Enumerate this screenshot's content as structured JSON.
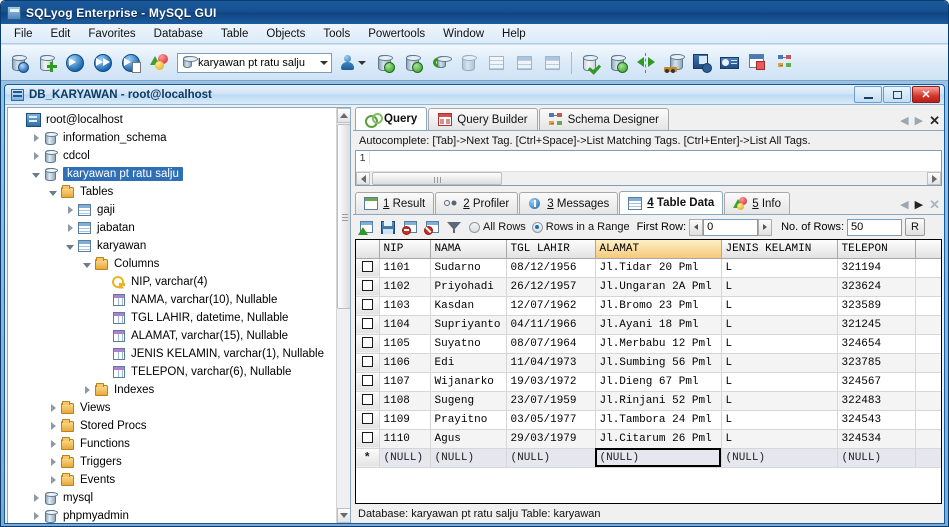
{
  "window": {
    "title": "SQLyog Enterprise - MySQL GUI",
    "icon": "sqlyog-app-icon"
  },
  "menu": {
    "items": [
      {
        "label": "File"
      },
      {
        "label": "Edit"
      },
      {
        "label": "Favorites"
      },
      {
        "label": "Database"
      },
      {
        "label": "Table"
      },
      {
        "label": "Objects"
      },
      {
        "label": "Tools"
      },
      {
        "label": "Powertools"
      },
      {
        "label": "Window"
      },
      {
        "label": "Help"
      }
    ]
  },
  "toolbar": {
    "db_selector_value": "karyawan pt ratu salju",
    "buttons": [
      {
        "name": "new-connection-icon"
      },
      {
        "name": "add-connection-icon"
      },
      {
        "name": "execute-query-icon"
      },
      {
        "name": "execute-all-queries-icon"
      },
      {
        "name": "execute-query-to-file-icon"
      },
      {
        "name": "refresh-object-browser-icon"
      }
    ],
    "buttons_right": [
      {
        "name": "user-manager-icon"
      },
      {
        "name": "import-data-icon"
      },
      {
        "name": "export-data-icon"
      },
      {
        "name": "restore-backup-icon"
      },
      {
        "name": "backup-database-icon"
      },
      {
        "name": "export-to-csv-icon"
      },
      {
        "name": "create-table-icon"
      },
      {
        "name": "alter-table-icon"
      },
      {
        "name": "sql-formatter-icon"
      },
      {
        "name": "database-sync-icon"
      },
      {
        "name": "data-sync-icon"
      },
      {
        "name": "migration-toolkit-icon"
      },
      {
        "name": "scheduled-backup-icon"
      },
      {
        "name": "notification-services-icon"
      },
      {
        "name": "query-formatter-icon"
      },
      {
        "name": "schema-designer-icon"
      }
    ]
  },
  "child_window": {
    "title": "DB_KARYAWAN - root@localhost",
    "controls": {
      "minimize": "minimize-button",
      "maximize": "maximize-button",
      "close": "close-button"
    }
  },
  "tree": {
    "nodes": [
      {
        "label": "root@localhost",
        "icon": "server-icon",
        "indent": 0,
        "twisty": "none",
        "selected": false
      },
      {
        "label": "information_schema",
        "icon": "database-icon",
        "indent": 1,
        "twisty": "closed",
        "selected": false
      },
      {
        "label": "cdcol",
        "icon": "database-icon",
        "indent": 1,
        "twisty": "closed",
        "selected": false
      },
      {
        "label": "karyawan pt ratu salju",
        "icon": "database-icon",
        "indent": 1,
        "twisty": "open",
        "selected": true
      },
      {
        "label": "Tables",
        "icon": "folder-icon",
        "indent": 2,
        "twisty": "open",
        "selected": false
      },
      {
        "label": "gaji",
        "icon": "table-icon",
        "indent": 3,
        "twisty": "closed",
        "selected": false
      },
      {
        "label": "jabatan",
        "icon": "table-icon",
        "indent": 3,
        "twisty": "closed",
        "selected": false
      },
      {
        "label": "karyawan",
        "icon": "table-icon",
        "indent": 3,
        "twisty": "open",
        "selected": false
      },
      {
        "label": "Columns",
        "icon": "folder-icon",
        "indent": 4,
        "twisty": "open",
        "selected": false
      },
      {
        "label": "NIP, varchar(4)",
        "icon": "primary-key-icon",
        "indent": 5,
        "twisty": "none",
        "selected": false
      },
      {
        "label": "NAMA, varchar(10), Nullable",
        "icon": "column-icon",
        "indent": 5,
        "twisty": "none",
        "selected": false
      },
      {
        "label": "TGL LAHIR, datetime, Nullable",
        "icon": "column-icon",
        "indent": 5,
        "twisty": "none",
        "selected": false
      },
      {
        "label": "ALAMAT, varchar(15), Nullable",
        "icon": "column-icon",
        "indent": 5,
        "twisty": "none",
        "selected": false
      },
      {
        "label": "JENIS KELAMIN, varchar(1), Nullable",
        "icon": "column-icon",
        "indent": 5,
        "twisty": "none",
        "selected": false
      },
      {
        "label": "TELEPON, varchar(6), Nullable",
        "icon": "column-icon",
        "indent": 5,
        "twisty": "none",
        "selected": false
      },
      {
        "label": "Indexes",
        "icon": "folder-icon",
        "indent": 4,
        "twisty": "closed",
        "selected": false
      },
      {
        "label": "Views",
        "icon": "folder-icon",
        "indent": 2,
        "twisty": "closed",
        "selected": false
      },
      {
        "label": "Stored Procs",
        "icon": "folder-icon",
        "indent": 2,
        "twisty": "closed",
        "selected": false
      },
      {
        "label": "Functions",
        "icon": "folder-icon",
        "indent": 2,
        "twisty": "closed",
        "selected": false
      },
      {
        "label": "Triggers",
        "icon": "folder-icon",
        "indent": 2,
        "twisty": "closed",
        "selected": false
      },
      {
        "label": "Events",
        "icon": "folder-icon",
        "indent": 2,
        "twisty": "closed",
        "selected": false
      },
      {
        "label": "mysql",
        "icon": "database-icon",
        "indent": 1,
        "twisty": "closed",
        "selected": false
      },
      {
        "label": "phpmyadmin",
        "icon": "database-icon",
        "indent": 1,
        "twisty": "closed",
        "selected": false
      }
    ]
  },
  "editor_tabs": {
    "tabs": [
      {
        "label": "Query",
        "icon": "query-icon",
        "active": true
      },
      {
        "label": "Query Builder",
        "icon": "query-builder-icon",
        "active": false
      },
      {
        "label": "Schema Designer",
        "icon": "schema-designer-icon",
        "active": false
      }
    ]
  },
  "autocomplete_hint": "Autocomplete: [Tab]->Next Tag. [Ctrl+Space]->List Matching Tags. [Ctrl+Enter]->List All Tags.",
  "sql_editor": {
    "line_number": "1",
    "text": ""
  },
  "result_tabs": {
    "tabs": [
      {
        "num": "1",
        "label": "Result",
        "icon": "result-grid-icon",
        "active": false
      },
      {
        "num": "2",
        "label": "Profiler",
        "icon": "profiler-icon",
        "active": false
      },
      {
        "num": "3",
        "label": "Messages",
        "icon": "messages-icon",
        "active": false
      },
      {
        "num": "4",
        "label": "Table Data",
        "icon": "table-data-icon",
        "active": true
      },
      {
        "num": "5",
        "label": "Info",
        "icon": "info-icon",
        "active": false
      }
    ]
  },
  "grid_toolbar": {
    "icons": [
      {
        "name": "insert-row-icon"
      },
      {
        "name": "save-changes-icon"
      },
      {
        "name": "delete-row-icon"
      },
      {
        "name": "discard-changes-icon"
      },
      {
        "name": "filter-icon"
      }
    ],
    "all_rows_label": "All Rows",
    "all_rows_selected": false,
    "rows_in_range_label": "Rows in a Range",
    "rows_in_range_selected": true,
    "first_row_label": "First Row:",
    "first_row_value": "0",
    "no_of_rows_label": "No. of Rows:",
    "no_of_rows_value": "50",
    "refresh_label": "R"
  },
  "grid": {
    "columns": [
      {
        "key": "NIP",
        "label": "NIP",
        "highlight": false
      },
      {
        "key": "NAMA",
        "label": "NAMA",
        "highlight": false
      },
      {
        "key": "TGL_LAHIR",
        "label": "TGL LAHIR",
        "highlight": false
      },
      {
        "key": "ALAMAT",
        "label": "ALAMAT",
        "highlight": true
      },
      {
        "key": "JENIS_KELAMIN",
        "label": "JENIS KELAMIN",
        "highlight": false
      },
      {
        "key": "TELEPON",
        "label": "TELEPON",
        "highlight": false
      }
    ],
    "rows": [
      {
        "NIP": "1101",
        "NAMA": "Sudarno",
        "TGL_LAHIR": "08/12/1956",
        "ALAMAT": "Jl.Tidar 20 Pml",
        "JENIS_KELAMIN": "L",
        "TELEPON": "321194"
      },
      {
        "NIP": "1102",
        "NAMA": "Priyohadi",
        "TGL_LAHIR": "26/12/1957",
        "ALAMAT": "Jl.Ungaran 2A Pml",
        "JENIS_KELAMIN": "L",
        "TELEPON": "323624"
      },
      {
        "NIP": "1103",
        "NAMA": "Kasdan",
        "TGL_LAHIR": "12/07/1962",
        "ALAMAT": "Jl.Bromo 23 Pml",
        "JENIS_KELAMIN": "L",
        "TELEPON": "323589"
      },
      {
        "NIP": "1104",
        "NAMA": "Supriyanto",
        "TGL_LAHIR": "04/11/1966",
        "ALAMAT": "Jl.Ayani 18 Pml",
        "JENIS_KELAMIN": "L",
        "TELEPON": "321245"
      },
      {
        "NIP": "1105",
        "NAMA": "Suyatno",
        "TGL_LAHIR": "08/07/1964",
        "ALAMAT": "Jl.Merbabu 12 Pml",
        "JENIS_KELAMIN": "L",
        "TELEPON": "324654"
      },
      {
        "NIP": "1106",
        "NAMA": "Edi",
        "TGL_LAHIR": "11/04/1973",
        "ALAMAT": "Jl.Sumbing 56 Pml",
        "JENIS_KELAMIN": "L",
        "TELEPON": "323785"
      },
      {
        "NIP": "1107",
        "NAMA": "Wijanarko",
        "TGL_LAHIR": "19/03/1972",
        "ALAMAT": "Jl.Dieng 67 Pml",
        "JENIS_KELAMIN": "L",
        "TELEPON": "324567"
      },
      {
        "NIP": "1108",
        "NAMA": "Sugeng",
        "TGL_LAHIR": "23/07/1959",
        "ALAMAT": "Jl.Rinjani 52 Pml",
        "JENIS_KELAMIN": "L",
        "TELEPON": "322483"
      },
      {
        "NIP": "1109",
        "NAMA": "Prayitno",
        "TGL_LAHIR": "03/05/1977",
        "ALAMAT": "Jl.Tambora 24 Pml",
        "JENIS_KELAMIN": "L",
        "TELEPON": "324543"
      },
      {
        "NIP": "1110",
        "NAMA": "Agus",
        "TGL_LAHIR": "29/03/1979",
        "ALAMAT": "Jl.Citarum 26 Pml",
        "JENIS_KELAMIN": "L",
        "TELEPON": "324534"
      }
    ],
    "new_row": {
      "marker": "*",
      "NIP": "(NULL)",
      "NAMA": "(NULL)",
      "TGL_LAHIR": "(NULL)",
      "ALAMAT": "(NULL)",
      "JENIS_KELAMIN": "(NULL)",
      "TELEPON": "(NULL)",
      "focused_column": "ALAMAT"
    }
  },
  "status_bar": {
    "text": "Database: karyawan pt ratu salju Table: karyawan"
  },
  "colors": {
    "titlebar": "#17508f",
    "selection": "#2f6fb5",
    "highlight_column": "#f5c97a",
    "close_button": "#c8281e"
  }
}
